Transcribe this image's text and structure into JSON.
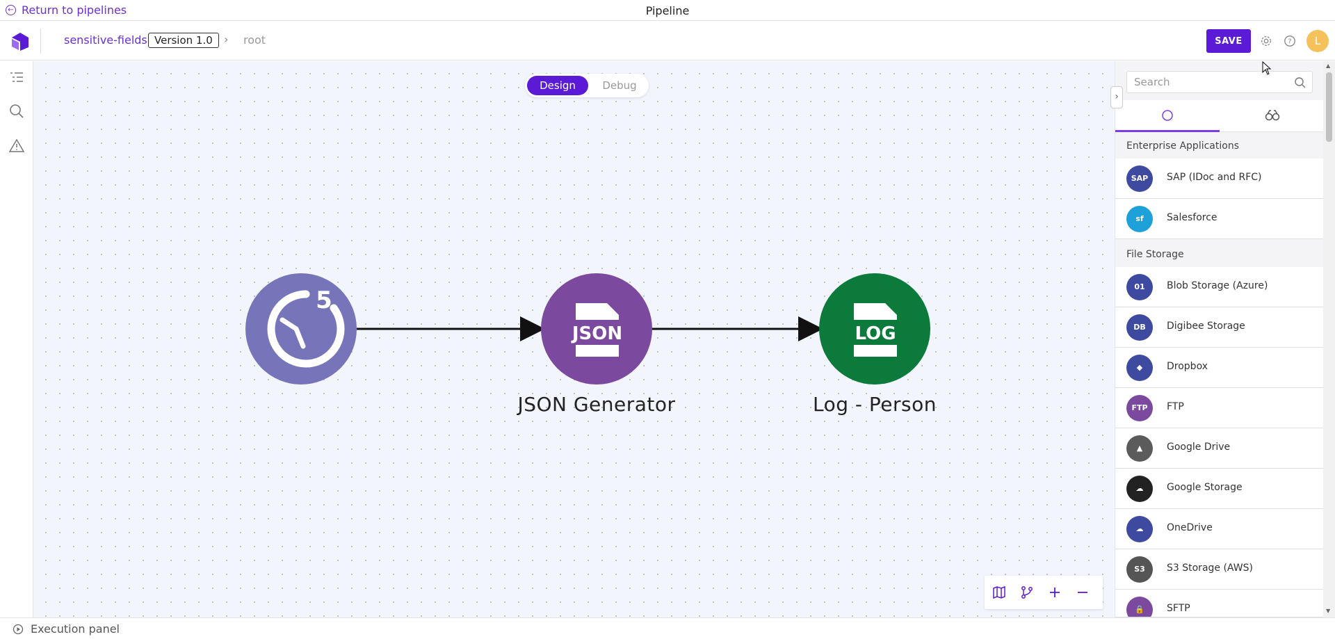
{
  "top": {
    "back_label": "Return to pipelines",
    "title": "Pipeline"
  },
  "header": {
    "pipeline_name": "sensitive-fields",
    "version": "Version 1.0",
    "crumb": "root",
    "save_label": "SAVE",
    "avatar_initial": "L"
  },
  "canvas": {
    "mode_design": "Design",
    "mode_debug": "Debug",
    "nodes": [
      {
        "label": "",
        "badge": "5",
        "icon": "timer-icon",
        "color": "#7775b9"
      },
      {
        "label": "JSON Generator",
        "icon_text": "JSON",
        "icon": "json-file-icon",
        "color": "#7b4a9e"
      },
      {
        "label": "Log - Person",
        "icon_text": "LOG",
        "icon": "log-file-icon",
        "color": "#0b7a3b"
      }
    ]
  },
  "panel": {
    "search_placeholder": "Search",
    "groups": [
      {
        "title": "Enterprise Applications",
        "items": [
          {
            "label": "SAP (IDoc and RFC)",
            "icon": "sap-icon",
            "color": "#3e4aa0",
            "text": "SAP"
          },
          {
            "label": "Salesforce",
            "icon": "salesforce-icon",
            "color": "#1ea0d8",
            "text": "sf"
          }
        ]
      },
      {
        "title": "File Storage",
        "items": [
          {
            "label": "Blob Storage (Azure)",
            "icon": "azure-blob-icon",
            "color": "#3e4aa0",
            "text": "01"
          },
          {
            "label": "Digibee Storage",
            "icon": "digibee-storage-icon",
            "color": "#3e4aa0",
            "text": "DB"
          },
          {
            "label": "Dropbox",
            "icon": "dropbox-icon",
            "color": "#3e4aa0",
            "text": "◆"
          },
          {
            "label": "FTP",
            "icon": "ftp-icon",
            "color": "#7b4a9e",
            "text": "FTP"
          },
          {
            "label": "Google Drive",
            "icon": "google-drive-icon",
            "color": "#5b5b5b",
            "text": "▲"
          },
          {
            "label": "Google Storage",
            "icon": "google-storage-icon",
            "color": "#222222",
            "text": "☁"
          },
          {
            "label": "OneDrive",
            "icon": "onedrive-icon",
            "color": "#3e4aa0",
            "text": "☁"
          },
          {
            "label": "S3 Storage (AWS)",
            "icon": "aws-s3-icon",
            "color": "#555555",
            "text": "S3"
          },
          {
            "label": "SFTP",
            "icon": "sftp-icon",
            "color": "#7b4a9e",
            "text": "🔒"
          }
        ]
      }
    ]
  },
  "bottom": {
    "execution_label": "Execution panel"
  },
  "colors": {
    "accent": "#5b1ad6",
    "canvas_bg": "#f3f5fd"
  }
}
